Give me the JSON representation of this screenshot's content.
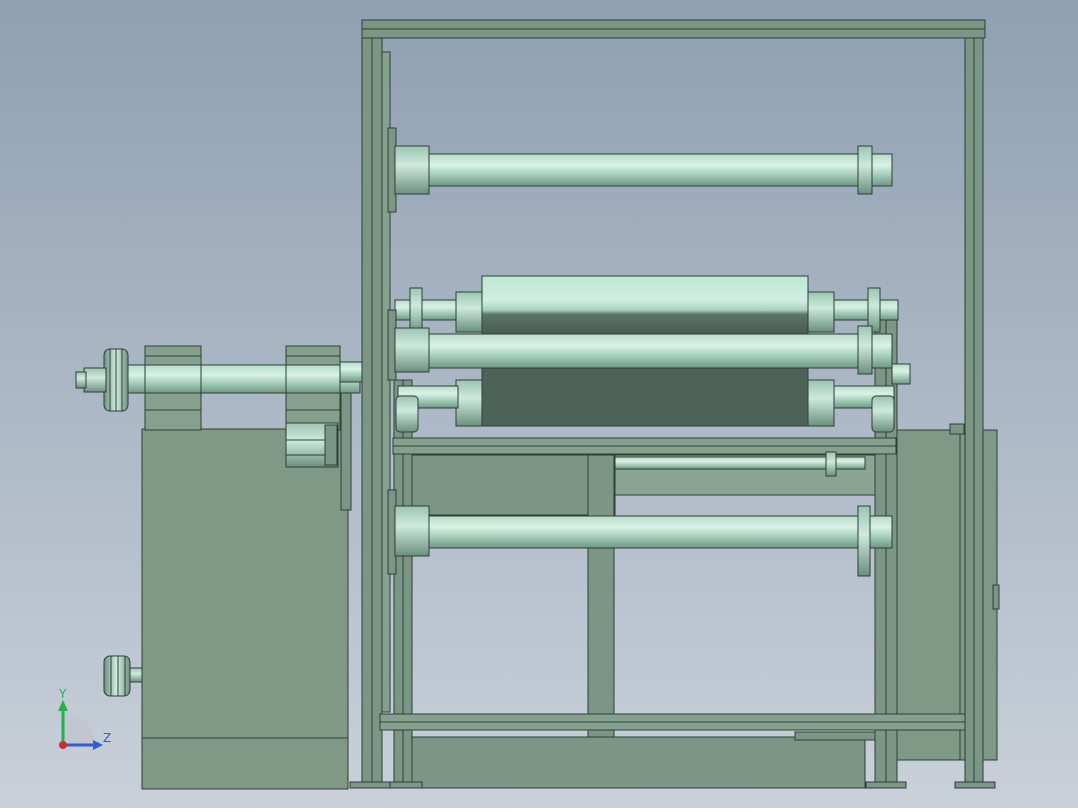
{
  "viewport": {
    "background_top": "#8fa0b2",
    "background_bottom": "#c9d0d9"
  },
  "palette": {
    "frame": "#7c9685",
    "frame_dark": "#5f7a6a",
    "panel": "#7f9987",
    "outline": "#2e3f36",
    "roller_light": "#d9f2e6",
    "roller_mid": "#a9d1bf",
    "roller_dark": "#6f9784",
    "drum_light": "#cfeee1",
    "drum_dark": "#44584f"
  },
  "triad": {
    "y_label": "Y",
    "z_label": "Z",
    "y_color": "#22b14c",
    "z_color": "#2f5fd0",
    "origin_color": "#d22d2d"
  }
}
